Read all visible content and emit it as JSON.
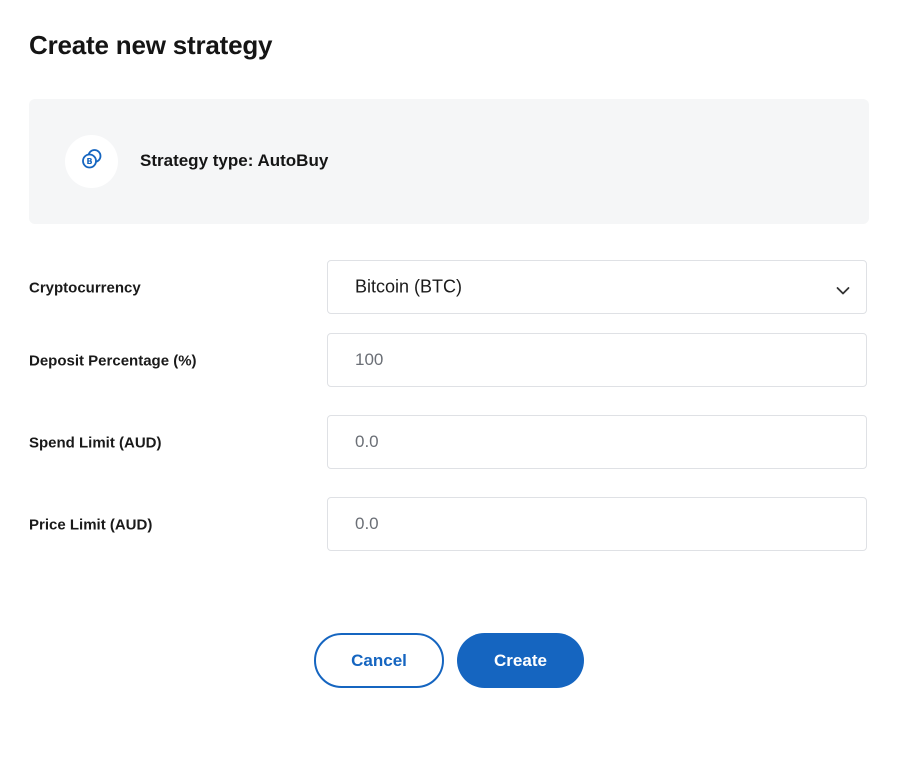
{
  "page": {
    "title": "Create new strategy"
  },
  "strategy_type": {
    "label": "Strategy type: AutoBuy",
    "icon": "bitcoin-coins-icon"
  },
  "form": {
    "cryptocurrency": {
      "label": "Cryptocurrency",
      "selected": "Bitcoin (BTC)"
    },
    "deposit_percentage": {
      "label": "Deposit Percentage (%)",
      "placeholder": "100"
    },
    "spend_limit": {
      "label": "Spend Limit (AUD)",
      "placeholder": "0.0"
    },
    "price_limit": {
      "label": "Price Limit (AUD)",
      "placeholder": "0.0"
    }
  },
  "actions": {
    "cancel_label": "Cancel",
    "create_label": "Create"
  },
  "colors": {
    "accent": "#1565c0",
    "card_background": "#f5f6f7",
    "field_border": "#dfe1e5"
  }
}
